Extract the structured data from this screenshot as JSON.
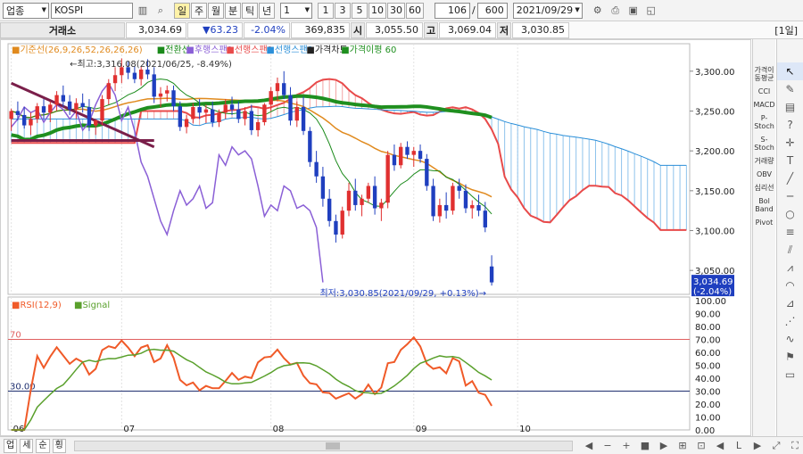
{
  "toolbar": {
    "market_select": "업종",
    "index_input": "KOSPI",
    "period_buttons": [
      "일",
      "주",
      "월",
      "분",
      "틱",
      "년"
    ],
    "interval_value": "1",
    "quick_buttons": [
      "1",
      "3",
      "5",
      "10",
      "30",
      "60"
    ],
    "count_value": "106",
    "slash": "/",
    "total_value": "600",
    "date_value": "2021/09/29",
    "period_label": "[1일]"
  },
  "quote": {
    "exchange": "거래소",
    "price": "3,034.69",
    "change": "▼63.23",
    "change_pct": "-2.04%",
    "volume": "369,835",
    "open_label": "시",
    "open": "3,055.50",
    "high_label": "고",
    "high": "3,069.04",
    "low_label": "저",
    "low": "3,030.85"
  },
  "legend": [
    {
      "text": "기준선(26,9,26,52,26,26,26)",
      "color": "#e08a1e"
    },
    {
      "text": "전환선",
      "color": "#1a8a1a"
    },
    {
      "text": "후행스팬1",
      "color": "#8a5fd6"
    },
    {
      "text": "선행스팬1",
      "color": "#e84a4a"
    },
    {
      "text": "선행스팬2",
      "color": "#2b8fd8"
    },
    {
      "text": "가격차트",
      "color": "#222222"
    },
    {
      "text": "가격이평 60",
      "color": "#1f8f1f"
    }
  ],
  "annotations": {
    "high_note": "←최고:3,316.08(2021/06/25, -8.49%)",
    "low_note": "최저:3,030.85(2021/09/29, +0.13%)→",
    "price_tag": "3,034.69",
    "price_tag_pct": "(-2.04%)",
    "rsi_30_label": "30.00",
    "rsi_70_label": "70"
  },
  "rsi_legend": {
    "rsi": "RSI(12,9)",
    "signal": "Signal"
  },
  "y_axis_labels": [
    "3,300.00",
    "3,250.00",
    "3,200.00",
    "3,150.00",
    "3,100.00",
    "3,050.00"
  ],
  "rsi_axis_labels": [
    "100.00",
    "90.00",
    "80.00",
    "70.00",
    "60.00",
    "50.00",
    "40.00",
    "30.00",
    "20.00",
    "10.00",
    "0.00"
  ],
  "x_labels": [
    "06",
    "07",
    "08",
    "09",
    "10"
  ],
  "right_tools": [
    "가격이동평균",
    "CCI",
    "MACD",
    "P-Stoch",
    "S-Stoch",
    "거래량",
    "OBV",
    "심리선",
    "Bol Band",
    "Pivot"
  ],
  "bottom_tabs": [
    "업",
    "세",
    "순",
    "횡"
  ],
  "colors": {
    "up": "#e03030",
    "down": "#1f3fbf",
    "ma60": "#1f8f1f",
    "lagging": "#8a5fd6",
    "base": "#e08a1e",
    "conv": "#1a8a1a",
    "span1": "#e84a4a",
    "span2": "#2b8fd8"
  },
  "chart_data": {
    "type": "candlestick",
    "x_ticks": [
      "06",
      "07",
      "08",
      "09",
      "10"
    ],
    "ylim": [
      3020,
      3330
    ],
    "rsi_ylim": [
      0,
      100
    ],
    "rsi_levels": [
      30,
      70
    ],
    "current": 3034.69,
    "period_high": 3316.08,
    "period_low": 3030.85,
    "candles": [
      [
        3240,
        3253,
        3225,
        3250
      ],
      [
        3250,
        3262,
        3238,
        3245
      ],
      [
        3245,
        3255,
        3228,
        3232
      ],
      [
        3232,
        3248,
        3220,
        3240
      ],
      [
        3240,
        3260,
        3235,
        3256
      ],
      [
        3256,
        3265,
        3240,
        3248
      ],
      [
        3248,
        3262,
        3236,
        3258
      ],
      [
        3258,
        3275,
        3250,
        3270
      ],
      [
        3270,
        3282,
        3255,
        3262
      ],
      [
        3262,
        3270,
        3245,
        3252
      ],
      [
        3252,
        3266,
        3240,
        3260
      ],
      [
        3260,
        3272,
        3248,
        3255
      ],
      [
        3255,
        3265,
        3225,
        3232
      ],
      [
        3232,
        3240,
        3220,
        3238
      ],
      [
        3238,
        3270,
        3232,
        3265
      ],
      [
        3265,
        3290,
        3258,
        3285
      ],
      [
        3285,
        3305,
        3275,
        3295
      ],
      [
        3295,
        3316,
        3285,
        3305
      ],
      [
        3305,
        3312,
        3290,
        3298
      ],
      [
        3298,
        3306,
        3285,
        3290
      ],
      [
        3290,
        3306,
        3282,
        3302
      ],
      [
        3302,
        3315,
        3290,
        3296
      ],
      [
        3296,
        3305,
        3260,
        3268
      ],
      [
        3268,
        3280,
        3255,
        3272
      ],
      [
        3272,
        3282,
        3262,
        3276
      ],
      [
        3276,
        3282,
        3250,
        3256
      ],
      [
        3256,
        3262,
        3225,
        3230
      ],
      [
        3230,
        3245,
        3222,
        3240
      ],
      [
        3240,
        3260,
        3235,
        3255
      ],
      [
        3255,
        3265,
        3240,
        3248
      ],
      [
        3248,
        3258,
        3235,
        3252
      ],
      [
        3252,
        3262,
        3230,
        3236
      ],
      [
        3236,
        3252,
        3230,
        3248
      ],
      [
        3248,
        3265,
        3240,
        3258
      ],
      [
        3258,
        3268,
        3245,
        3252
      ],
      [
        3252,
        3262,
        3235,
        3240
      ],
      [
        3240,
        3255,
        3232,
        3250
      ],
      [
        3250,
        3258,
        3220,
        3226
      ],
      [
        3226,
        3240,
        3218,
        3236
      ],
      [
        3236,
        3260,
        3232,
        3258
      ],
      [
        3258,
        3280,
        3250,
        3275
      ],
      [
        3275,
        3292,
        3262,
        3285
      ],
      [
        3285,
        3300,
        3265,
        3270
      ],
      [
        3270,
        3280,
        3232,
        3238
      ],
      [
        3238,
        3262,
        3230,
        3255
      ],
      [
        3255,
        3268,
        3220,
        3225
      ],
      [
        3225,
        3230,
        3180,
        3186
      ],
      [
        3186,
        3200,
        3160,
        3168
      ],
      [
        3168,
        3180,
        3130,
        3140
      ],
      [
        3140,
        3152,
        3105,
        3112
      ],
      [
        3112,
        3120,
        3085,
        3095
      ],
      [
        3095,
        3130,
        3090,
        3125
      ],
      [
        3125,
        3160,
        3118,
        3150
      ],
      [
        3150,
        3165,
        3125,
        3132
      ],
      [
        3132,
        3145,
        3118,
        3140
      ],
      [
        3140,
        3160,
        3135,
        3156
      ],
      [
        3156,
        3168,
        3120,
        3128
      ],
      [
        3128,
        3140,
        3112,
        3135
      ],
      [
        3135,
        3200,
        3128,
        3195
      ],
      [
        3195,
        3208,
        3175,
        3182
      ],
      [
        3182,
        3210,
        3178,
        3205
      ],
      [
        3205,
        3212,
        3190,
        3195
      ],
      [
        3195,
        3205,
        3180,
        3200
      ],
      [
        3200,
        3208,
        3185,
        3190
      ],
      [
        3190,
        3196,
        3150,
        3156
      ],
      [
        3156,
        3165,
        3112,
        3118
      ],
      [
        3118,
        3140,
        3110,
        3132
      ],
      [
        3132,
        3148,
        3115,
        3125
      ],
      [
        3125,
        3160,
        3120,
        3156
      ],
      [
        3156,
        3165,
        3140,
        3150
      ],
      [
        3150,
        3158,
        3122,
        3128
      ],
      [
        3128,
        3138,
        3115,
        3132
      ],
      [
        3132,
        3145,
        3118,
        3125
      ],
      [
        3125,
        3136,
        3098,
        3104
      ],
      [
        3055,
        3069,
        3031,
        3035
      ]
    ]
  }
}
